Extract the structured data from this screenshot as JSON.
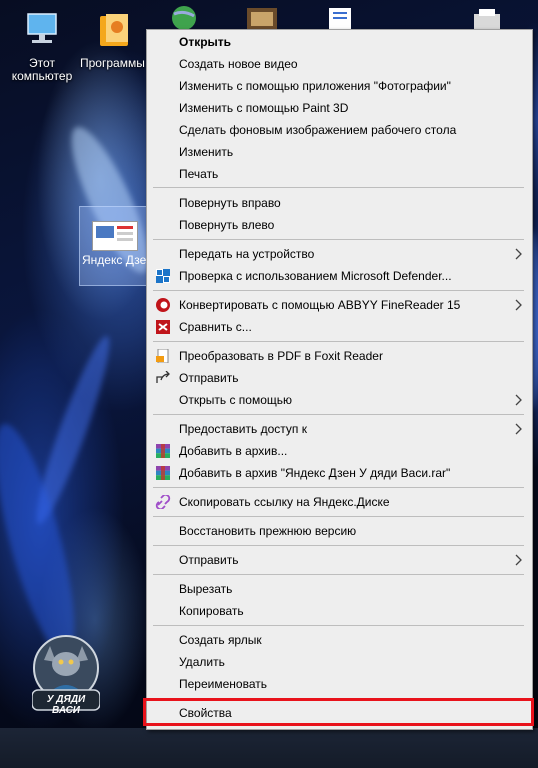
{
  "desktop": {
    "icons": [
      {
        "label": "Этот компьютер"
      },
      {
        "label": "Программы"
      }
    ],
    "selected_file": {
      "label": "Яндекс Дзен У дяди Васи"
    },
    "logo_text": "У ДЯДИ ВАСИ"
  },
  "context_menu": {
    "items": [
      {
        "label": "Открыть",
        "icon": "",
        "submenu": false,
        "bold": true
      },
      {
        "label": "Создать новое видео",
        "icon": "",
        "submenu": false
      },
      {
        "label": "Изменить с помощью приложения \"Фотографии\"",
        "icon": "",
        "submenu": false
      },
      {
        "label": "Изменить с помощью Paint 3D",
        "icon": "",
        "submenu": false
      },
      {
        "label": "Сделать фоновым изображением рабочего стола",
        "icon": "",
        "submenu": false
      },
      {
        "label": "Изменить",
        "icon": "",
        "submenu": false
      },
      {
        "label": "Печать",
        "icon": "",
        "submenu": false
      },
      {
        "label": "Повернуть вправо",
        "icon": "",
        "submenu": false
      },
      {
        "label": "Повернуть влево",
        "icon": "",
        "submenu": false
      },
      {
        "label": "Передать на устройство",
        "icon": "",
        "submenu": true
      },
      {
        "label": "Проверка с использованием Microsoft Defender...",
        "icon": "defender-shield-icon",
        "submenu": false
      },
      {
        "label": "Конвертировать с помощью ABBYY FineReader 15",
        "icon": "abbyy-icon",
        "submenu": true
      },
      {
        "label": "Сравнить с...",
        "icon": "compare-icon",
        "submenu": false
      },
      {
        "label": "Преобразовать в PDF в Foxit Reader",
        "icon": "foxit-pdf-icon",
        "submenu": false
      },
      {
        "label": "Отправить",
        "icon": "share-icon",
        "submenu": false
      },
      {
        "label": "Открыть с помощью",
        "icon": "",
        "submenu": true
      },
      {
        "label": "Предоставить доступ к",
        "icon": "",
        "submenu": true
      },
      {
        "label": "Добавить в архив...",
        "icon": "winrar-icon",
        "submenu": false
      },
      {
        "label": "Добавить в архив \"Яндекс Дзен У дяди Васи.rar\"",
        "icon": "winrar-icon",
        "submenu": false
      },
      {
        "label": "Скопировать ссылку на Яндекс.Диске",
        "icon": "yandex-disk-link-icon",
        "submenu": false
      },
      {
        "label": "Восстановить прежнюю версию",
        "icon": "",
        "submenu": false
      },
      {
        "label": "Отправить",
        "icon": "",
        "submenu": true
      },
      {
        "label": "Вырезать",
        "icon": "",
        "submenu": false
      },
      {
        "label": "Копировать",
        "icon": "",
        "submenu": false
      },
      {
        "label": "Создать ярлык",
        "icon": "",
        "submenu": false
      },
      {
        "label": "Удалить",
        "icon": "",
        "submenu": false
      },
      {
        "label": "Переименовать",
        "icon": "",
        "submenu": false
      },
      {
        "label": "Свойства",
        "icon": "",
        "submenu": false,
        "highlighted": true
      }
    ]
  },
  "colors": {
    "menu_bg": "#eeeeee",
    "highlight_border": "#e8121b"
  }
}
